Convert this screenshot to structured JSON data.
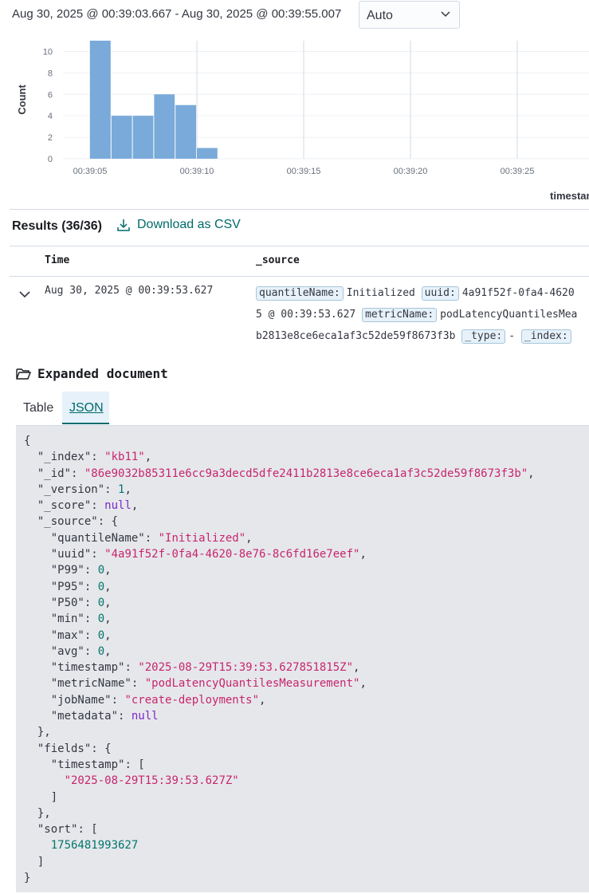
{
  "time_range": "Aug 30, 2025 @ 00:39:03.667 - Aug 30, 2025 @ 00:39:55.007",
  "interval": {
    "selected": "Auto"
  },
  "chart_data": {
    "type": "bar",
    "ylabel": "Count",
    "xlabel": "timestamp",
    "ylim": [
      0,
      10
    ],
    "yticks": [
      0,
      2,
      4,
      6,
      8,
      10
    ],
    "xticks": [
      "00:39:05",
      "00:39:10",
      "00:39:15",
      "00:39:20",
      "00:39:25"
    ],
    "x": [
      "00:39:05",
      "00:39:06",
      "00:39:07",
      "00:39:08",
      "00:39:09",
      "00:39:10"
    ],
    "values": [
      11,
      4,
      4,
      6,
      5,
      1
    ],
    "bar_color": "#79aad9",
    "grid": true
  },
  "results": {
    "title": "Results (36/36)",
    "download_label": "Download as CSV"
  },
  "table": {
    "columns": [
      "Time",
      "_source"
    ],
    "row": {
      "time": "Aug 30, 2025 @ 00:39:53.627",
      "source_lines": [
        [
          {
            "chip": "quantileName:",
            "text": "Initialized"
          },
          {
            "chip": "uuid:",
            "text": "4a91f52f-0fa4-4620"
          }
        ],
        [
          {
            "chip": "",
            "text": "5 @ 00:39:53.627"
          },
          {
            "chip": "metricName:",
            "text": "podLatencyQuantilesMea"
          }
        ],
        [
          {
            "chip": "",
            "text": "b2813e8ce6eca1af3c52de59f8673f3b"
          },
          {
            "chip": "_type:",
            "text": "-"
          },
          {
            "chip": "_index:",
            "text": ""
          }
        ]
      ]
    }
  },
  "expanded": {
    "title": "Expanded document",
    "tabs": [
      "Table",
      "JSON"
    ],
    "active_tab": "JSON",
    "json_lines": [
      [
        [
          "p",
          "{"
        ]
      ],
      [
        [
          "p",
          "  "
        ],
        [
          "k",
          "\"_index\""
        ],
        [
          "p",
          ": "
        ],
        [
          "s",
          "\"kb11\""
        ],
        [
          "p",
          ","
        ]
      ],
      [
        [
          "p",
          "  "
        ],
        [
          "k",
          "\"_id\""
        ],
        [
          "p",
          ": "
        ],
        [
          "s",
          "\"86e9032b85311e6cc9a3decd5dfe2411b2813e8ce6eca1af3c52de59f8673f3b\""
        ],
        [
          "p",
          ","
        ]
      ],
      [
        [
          "p",
          "  "
        ],
        [
          "k",
          "\"_version\""
        ],
        [
          "p",
          ": "
        ],
        [
          "n",
          "1"
        ],
        [
          "p",
          ","
        ]
      ],
      [
        [
          "p",
          "  "
        ],
        [
          "k",
          "\"_score\""
        ],
        [
          "p",
          ": "
        ],
        [
          "nl",
          "null"
        ],
        [
          "p",
          ","
        ]
      ],
      [
        [
          "p",
          "  "
        ],
        [
          "k",
          "\"_source\""
        ],
        [
          "p",
          ": {"
        ]
      ],
      [
        [
          "p",
          "    "
        ],
        [
          "k",
          "\"quantileName\""
        ],
        [
          "p",
          ": "
        ],
        [
          "s",
          "\"Initialized\""
        ],
        [
          "p",
          ","
        ]
      ],
      [
        [
          "p",
          "    "
        ],
        [
          "k",
          "\"uuid\""
        ],
        [
          "p",
          ": "
        ],
        [
          "s",
          "\"4a91f52f-0fa4-4620-8e76-8c6fd16e7eef\""
        ],
        [
          "p",
          ","
        ]
      ],
      [
        [
          "p",
          "    "
        ],
        [
          "k",
          "\"P99\""
        ],
        [
          "p",
          ": "
        ],
        [
          "n",
          "0"
        ],
        [
          "p",
          ","
        ]
      ],
      [
        [
          "p",
          "    "
        ],
        [
          "k",
          "\"P95\""
        ],
        [
          "p",
          ": "
        ],
        [
          "n",
          "0"
        ],
        [
          "p",
          ","
        ]
      ],
      [
        [
          "p",
          "    "
        ],
        [
          "k",
          "\"P50\""
        ],
        [
          "p",
          ": "
        ],
        [
          "n",
          "0"
        ],
        [
          "p",
          ","
        ]
      ],
      [
        [
          "p",
          "    "
        ],
        [
          "k",
          "\"min\""
        ],
        [
          "p",
          ": "
        ],
        [
          "n",
          "0"
        ],
        [
          "p",
          ","
        ]
      ],
      [
        [
          "p",
          "    "
        ],
        [
          "k",
          "\"max\""
        ],
        [
          "p",
          ": "
        ],
        [
          "n",
          "0"
        ],
        [
          "p",
          ","
        ]
      ],
      [
        [
          "p",
          "    "
        ],
        [
          "k",
          "\"avg\""
        ],
        [
          "p",
          ": "
        ],
        [
          "n",
          "0"
        ],
        [
          "p",
          ","
        ]
      ],
      [
        [
          "p",
          "    "
        ],
        [
          "k",
          "\"timestamp\""
        ],
        [
          "p",
          ": "
        ],
        [
          "s",
          "\"2025-08-29T15:39:53.627851815Z\""
        ],
        [
          "p",
          ","
        ]
      ],
      [
        [
          "p",
          "    "
        ],
        [
          "k",
          "\"metricName\""
        ],
        [
          "p",
          ": "
        ],
        [
          "s",
          "\"podLatencyQuantilesMeasurement\""
        ],
        [
          "p",
          ","
        ]
      ],
      [
        [
          "p",
          "    "
        ],
        [
          "k",
          "\"jobName\""
        ],
        [
          "p",
          ": "
        ],
        [
          "s",
          "\"create-deployments\""
        ],
        [
          "p",
          ","
        ]
      ],
      [
        [
          "p",
          "    "
        ],
        [
          "k",
          "\"metadata\""
        ],
        [
          "p",
          ": "
        ],
        [
          "nl",
          "null"
        ]
      ],
      [
        [
          "p",
          "  },"
        ]
      ],
      [
        [
          "p",
          "  "
        ],
        [
          "k",
          "\"fields\""
        ],
        [
          "p",
          ": {"
        ]
      ],
      [
        [
          "p",
          "    "
        ],
        [
          "k",
          "\"timestamp\""
        ],
        [
          "p",
          ": ["
        ]
      ],
      [
        [
          "p",
          "      "
        ],
        [
          "s",
          "\"2025-08-29T15:39:53.627Z\""
        ]
      ],
      [
        [
          "p",
          "    ]"
        ]
      ],
      [
        [
          "p",
          "  },"
        ]
      ],
      [
        [
          "p",
          "  "
        ],
        [
          "k",
          "\"sort\""
        ],
        [
          "p",
          ": ["
        ]
      ],
      [
        [
          "p",
          "    "
        ],
        [
          "n",
          "1756481993627"
        ]
      ],
      [
        [
          "p",
          "  ]"
        ]
      ],
      [
        [
          "p",
          "}"
        ]
      ]
    ]
  }
}
